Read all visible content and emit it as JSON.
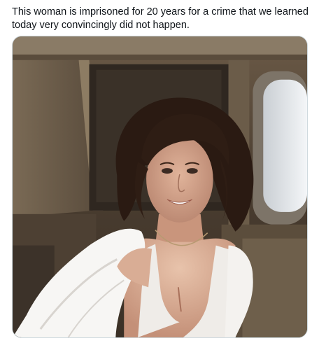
{
  "tweet": {
    "text": "This woman is imprisoned for 20 years for a crime that we learned today very convincingly did not happen."
  },
  "media": {
    "icon": "photo",
    "colors": {
      "background": "#ffffff",
      "text": "#0f1419",
      "border": "#cfd9de"
    }
  }
}
